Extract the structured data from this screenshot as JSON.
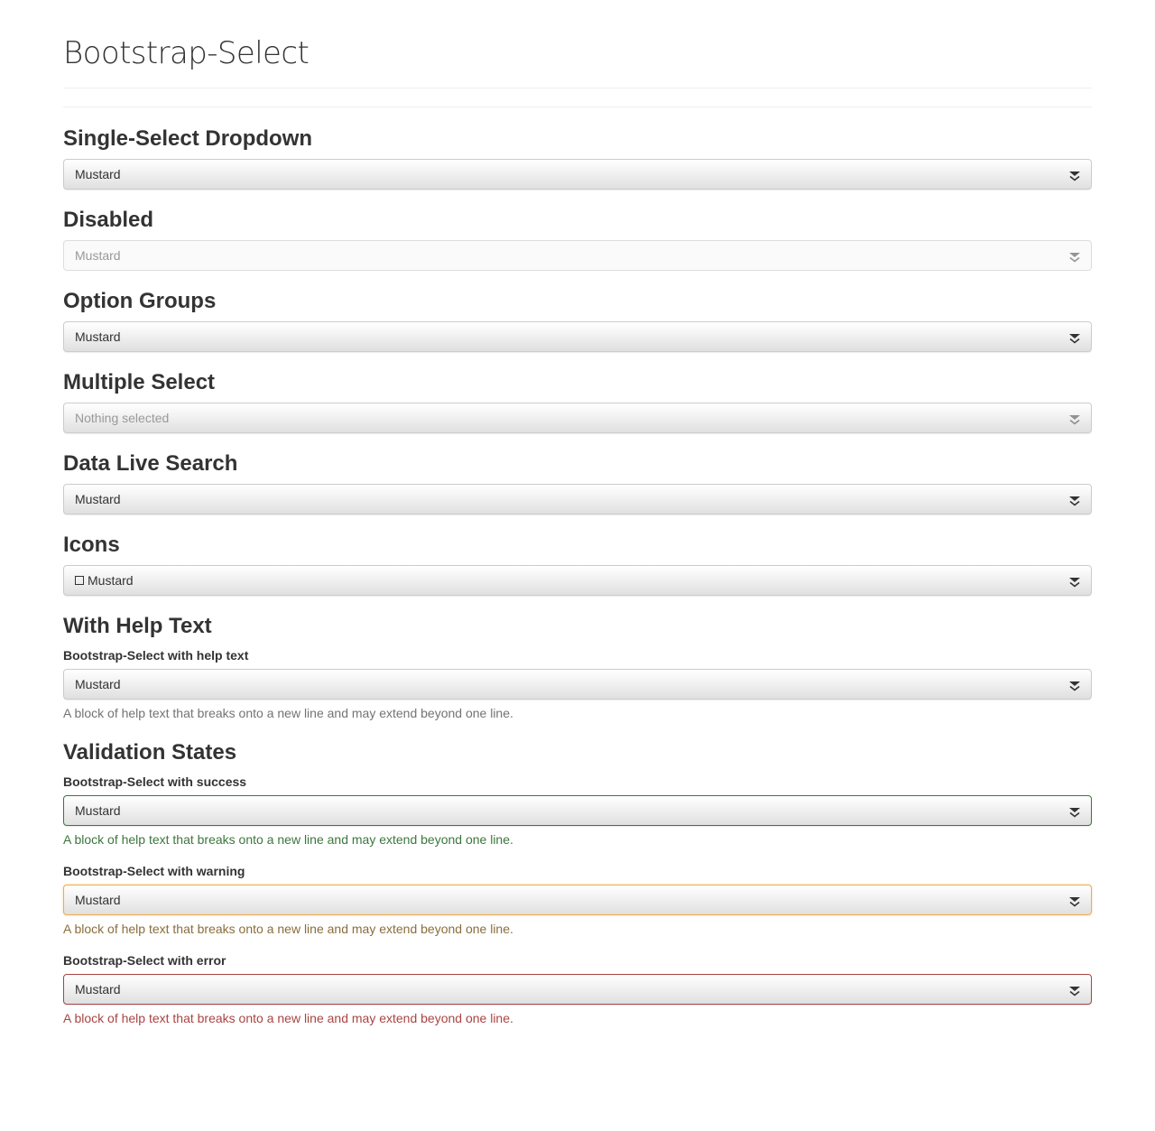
{
  "page": {
    "title": "Bootstrap-Select"
  },
  "colors": {
    "success": "#3c763d",
    "warning": "#f0ad4e",
    "warning_text": "#8a6d3b",
    "error": "#a94442"
  },
  "sections": {
    "single": {
      "heading": "Single-Select Dropdown",
      "value": "Mustard"
    },
    "disabled": {
      "heading": "Disabled",
      "value": "Mustard"
    },
    "option_groups": {
      "heading": "Option Groups",
      "value": "Mustard"
    },
    "multiple": {
      "heading": "Multiple Select",
      "placeholder": "Nothing selected"
    },
    "live_search": {
      "heading": "Data Live Search",
      "value": "Mustard"
    },
    "icons": {
      "heading": "Icons",
      "value": "Mustard",
      "item_icon": "square-outline-icon"
    },
    "help_text": {
      "heading": "With Help Text",
      "label": "Bootstrap-Select with help text",
      "value": "Mustard",
      "help": "A block of help text that breaks onto a new line and may extend beyond one line."
    },
    "validation": {
      "heading": "Validation States",
      "success": {
        "label": "Bootstrap-Select with success",
        "value": "Mustard",
        "help": "A block of help text that breaks onto a new line and may extend beyond one line."
      },
      "warning": {
        "label": "Bootstrap-Select with warning",
        "value": "Mustard",
        "help": "A block of help text that breaks onto a new line and may extend beyond one line."
      },
      "error": {
        "label": "Bootstrap-Select with error",
        "value": "Mustard",
        "help": "A block of help text that breaks onto a new line and may extend beyond one line."
      }
    }
  }
}
